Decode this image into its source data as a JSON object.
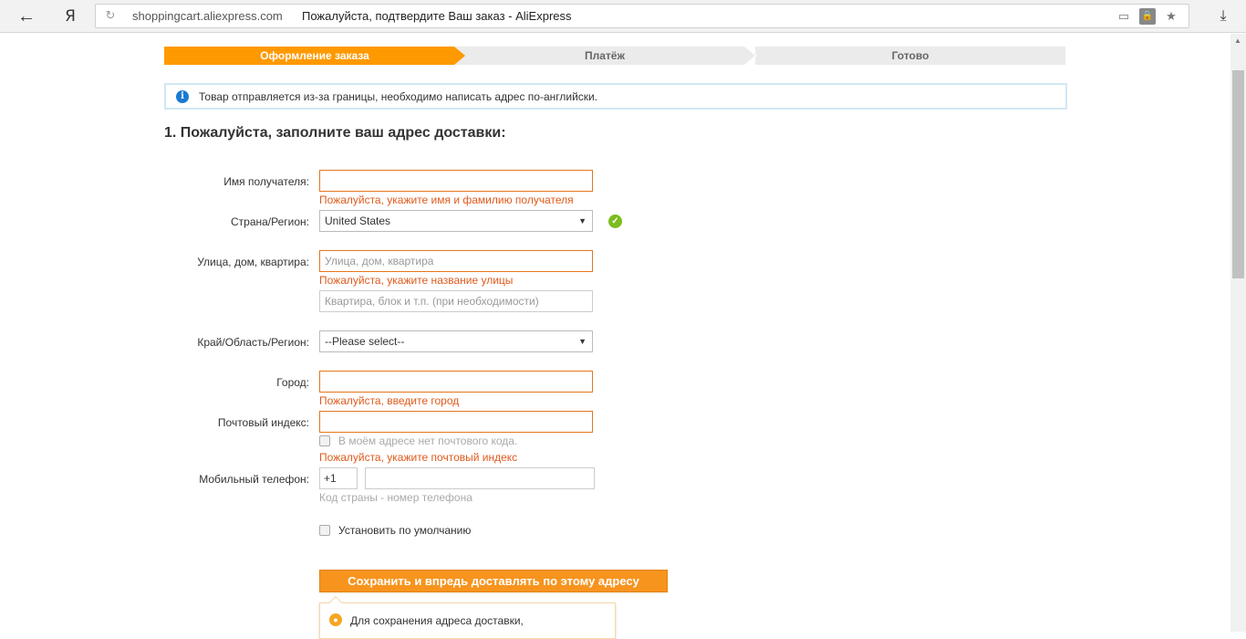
{
  "browser": {
    "back_icon": "←",
    "logo": "Я",
    "reload_icon": "↻",
    "domain": "shoppingcart.aliexpress.com",
    "title": "Пожалуйста, подтвердите Ваш заказ - AliExpress",
    "icons": [
      "camera-off-icon",
      "lock-icon",
      "star-icon",
      "download-icon"
    ]
  },
  "steps": [
    {
      "label": "Оформление заказа",
      "state": "active"
    },
    {
      "label": "Платёж",
      "state": "inactive"
    },
    {
      "label": "Готово",
      "state": "inactive"
    }
  ],
  "notice": {
    "icon": "info-icon",
    "text": "Товар отправляется из-за границы, необходимо написать адрес по-английски."
  },
  "section_title": "1. Пожалуйста, заполните ваш адрес доставки:",
  "form": {
    "recipient": {
      "label": "Имя получателя:",
      "value": "",
      "error": "Пожалуйста, укажите имя и фамилию получателя"
    },
    "country": {
      "label": "Страна/Регион:",
      "value": "United States",
      "valid_icon": "check-circle-icon"
    },
    "street": {
      "label": "Улица, дом, квартира:",
      "placeholder": "Улица, дом, квартира",
      "error": "Пожалуйста, укажите название улицы",
      "placeholder2": "Квартира, блок и т.п. (при необходимости)"
    },
    "region": {
      "label": "Край/Область/Регион:",
      "value": "--Please select--"
    },
    "city": {
      "label": "Город:",
      "value": "",
      "error": "Пожалуйста, введите город"
    },
    "zip": {
      "label": "Почтовый индекс:",
      "value": "",
      "no_zip_label": "В моём адресе нет почтового кода.",
      "error": "Пожалуйста, укажите почтовый индекс"
    },
    "phone": {
      "label": "Мобильный телефон:",
      "code": "+1",
      "number": "",
      "hint": "Код страны - номер телефона"
    },
    "default_label": "Установить по умолчанию",
    "save_label": "Сохранить и впредь доставлять по этому адресу",
    "tip_text": "Для сохранения адреса доставки,"
  },
  "colors": {
    "accent": "#ff9900",
    "error": "#e05a1b",
    "ok": "#7cbc1e",
    "info": "#1a7bd1"
  }
}
